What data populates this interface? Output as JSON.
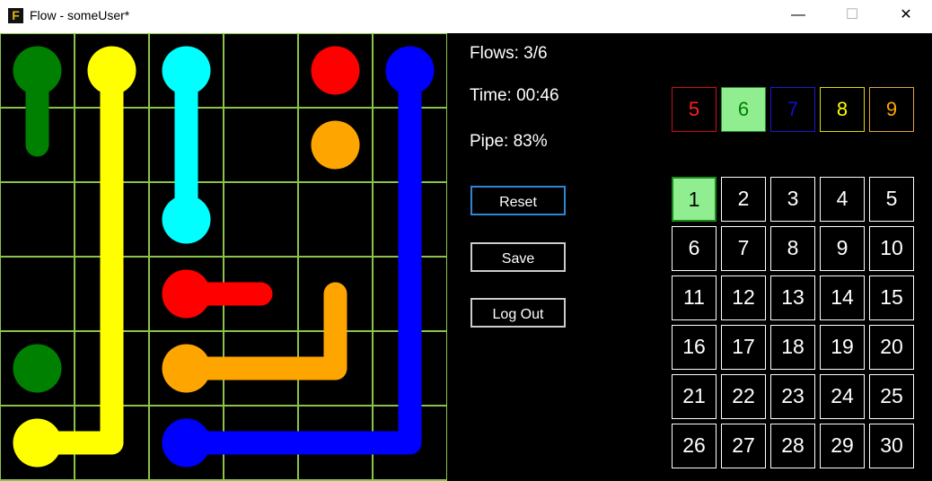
{
  "window": {
    "title": "Flow - someUser*",
    "app_icon": "F"
  },
  "status": {
    "flows": "Flows: 3/6",
    "time": "Time: 00:46",
    "pipe": "Pipe: 83%"
  },
  "buttons": {
    "reset": "Reset",
    "save": "Save",
    "logout": "Log Out"
  },
  "sizes": [
    {
      "label": "5",
      "color": "#ff2020",
      "border": "#cc1010",
      "bg": "#000000"
    },
    {
      "label": "6",
      "color": "#008000",
      "border": "#2c8c2c",
      "bg": "#90ee90"
    },
    {
      "label": "7",
      "color": "#1010cc",
      "border": "#1a1ad0",
      "bg": "#000000"
    },
    {
      "label": "8",
      "color": "#ffff00",
      "border": "#dddd00",
      "bg": "#000000"
    },
    {
      "label": "9",
      "color": "#ffa500",
      "border": "#e0a040",
      "bg": "#000000"
    }
  ],
  "levels": [
    "1",
    "2",
    "3",
    "4",
    "5",
    "6",
    "7",
    "8",
    "9",
    "10",
    "11",
    "12",
    "13",
    "14",
    "15",
    "16",
    "17",
    "18",
    "19",
    "20",
    "21",
    "22",
    "23",
    "24",
    "25",
    "26",
    "27",
    "28",
    "29",
    "30"
  ],
  "board": {
    "size": 6,
    "grid_color": "#8bc34a",
    "flows": [
      {
        "color": "#008000",
        "ends": [
          [
            0,
            0
          ],
          [
            4,
            0
          ]
        ],
        "path": [
          [
            0,
            0
          ],
          [
            1,
            0
          ]
        ]
      },
      {
        "color": "#ffff00",
        "ends": [
          [
            0,
            1
          ],
          [
            5,
            0
          ]
        ],
        "path": [
          [
            0,
            1
          ],
          [
            1,
            1
          ],
          [
            2,
            1
          ],
          [
            3,
            1
          ],
          [
            4,
            1
          ],
          [
            5,
            1
          ],
          [
            5,
            0
          ]
        ]
      },
      {
        "color": "#00ffff",
        "ends": [
          [
            0,
            2
          ],
          [
            2,
            2
          ]
        ],
        "path": [
          [
            0,
            2
          ],
          [
            1,
            2
          ],
          [
            2,
            2
          ]
        ]
      },
      {
        "color": "#ff0000",
        "ends": [
          [
            0,
            4
          ],
          [
            3,
            2
          ]
        ],
        "path": [
          [
            3,
            2
          ],
          [
            3,
            3
          ]
        ]
      },
      {
        "color": "#ffa500",
        "ends": [
          [
            1,
            4
          ],
          [
            4,
            2
          ]
        ],
        "path": [
          [
            4,
            2
          ],
          [
            4,
            3
          ],
          [
            4,
            4
          ],
          [
            3,
            4
          ]
        ]
      },
      {
        "color": "#0000ff",
        "ends": [
          [
            0,
            5
          ],
          [
            5,
            2
          ]
        ],
        "path": [
          [
            0,
            5
          ],
          [
            1,
            5
          ],
          [
            2,
            5
          ],
          [
            3,
            5
          ],
          [
            4,
            5
          ],
          [
            5,
            5
          ],
          [
            5,
            4
          ],
          [
            5,
            3
          ],
          [
            5,
            2
          ]
        ]
      }
    ]
  }
}
